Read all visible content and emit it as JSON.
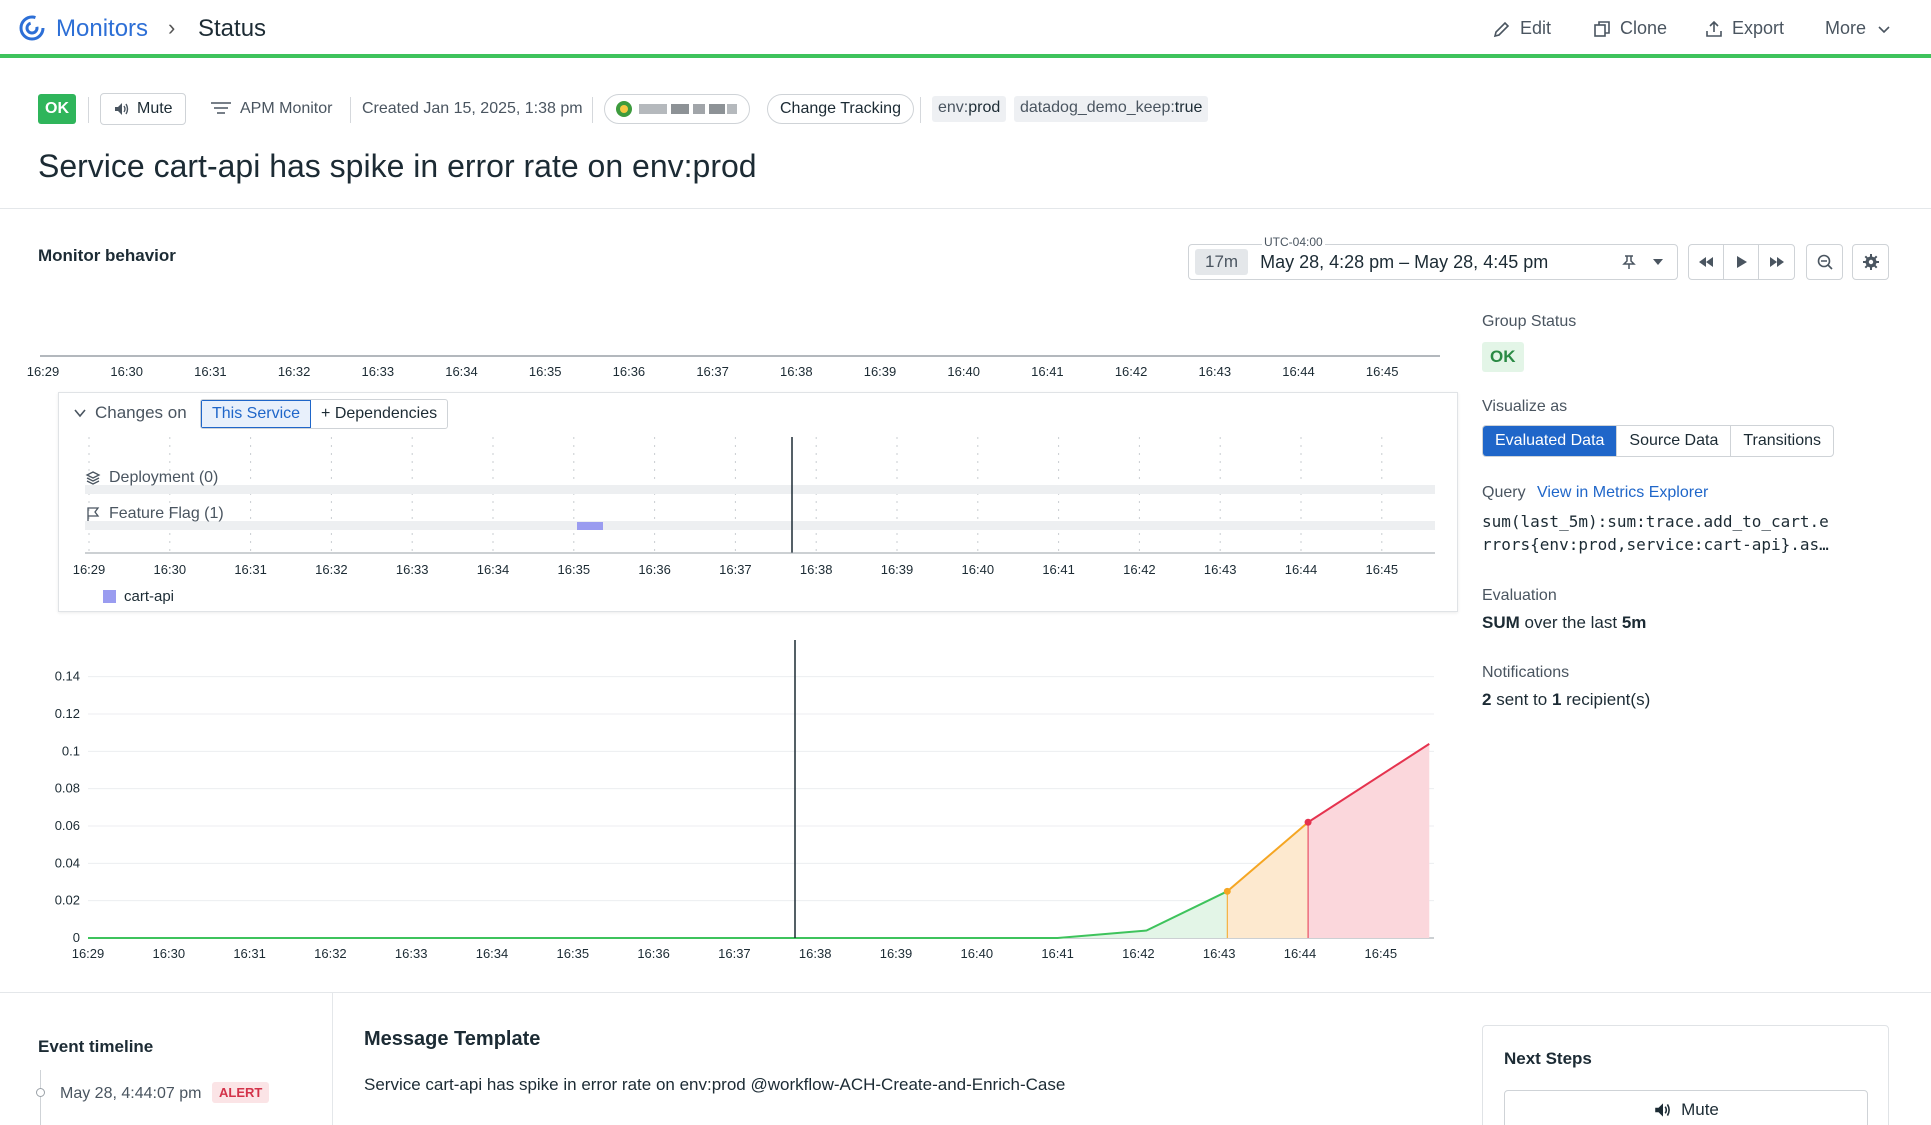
{
  "breadcrumb": {
    "root": "Monitors",
    "current": "Status"
  },
  "toolbar": {
    "edit": "Edit",
    "clone": "Clone",
    "export": "Export",
    "more": "More"
  },
  "header": {
    "status": "OK",
    "mute": "Mute",
    "monitor_type": "APM Monitor",
    "created": "Created Jan 15, 2025, 1:38 pm",
    "change_tracking": "Change Tracking",
    "tags": [
      {
        "key": "env:",
        "value": "prod"
      },
      {
        "key": "datadog_demo_keep:",
        "value": "true"
      }
    ],
    "title": "Service cart-api has spike in error rate on env:prod"
  },
  "behavior": {
    "title": "Monitor behavior",
    "timezone": "UTC-04:00",
    "duration": "17m",
    "range": "May 28, 4:28 pm – May 28, 4:45 pm"
  },
  "time_ticks": [
    "16:29",
    "16:30",
    "16:31",
    "16:32",
    "16:33",
    "16:34",
    "16:35",
    "16:36",
    "16:37",
    "16:38",
    "16:39",
    "16:40",
    "16:41",
    "16:42",
    "16:43",
    "16:44",
    "16:45"
  ],
  "changes": {
    "label": "Changes on",
    "this_service": "This Service",
    "dependencies": "+ Dependencies",
    "deployment": "Deployment (0)",
    "feature_flag": "Feature Flag (1)",
    "legend": "cart-api",
    "legend_color": "#9a9cf0"
  },
  "chart_data": {
    "type": "area",
    "x": [
      "16:29",
      "16:30",
      "16:31",
      "16:32",
      "16:33",
      "16:34",
      "16:35",
      "16:36",
      "16:37",
      "16:38",
      "16:39",
      "16:40",
      "16:41",
      "16:42",
      "16:43",
      "16:44",
      "16:45"
    ],
    "y_ticks": [
      "0",
      "0.02",
      "0.04",
      "0.06",
      "0.08",
      "0.1",
      "0.12",
      "0.14"
    ],
    "ylim": [
      0,
      0.15
    ],
    "points": [
      {
        "t": 0,
        "v": 0
      },
      {
        "t": 12,
        "v": 0
      },
      {
        "t": 13.1,
        "v": 0.004
      },
      {
        "t": 14.1,
        "v": 0.025
      },
      {
        "t": 15.1,
        "v": 0.062
      },
      {
        "t": 16.6,
        "v": 0.104
      }
    ],
    "marker_time": 8.75,
    "segments": [
      {
        "from": 0,
        "to": 3,
        "state": "ok",
        "color": "#3ec35c",
        "fill": "#e3f5e7"
      },
      {
        "from": 3,
        "to": 4,
        "state": "warn",
        "color": "#f5a623",
        "fill": "#fde9cf"
      },
      {
        "from": 4,
        "to": 5,
        "state": "alert",
        "color": "#e5334f",
        "fill": "#fbd7dc"
      }
    ]
  },
  "side": {
    "group_status_label": "Group Status",
    "group_status": "OK",
    "visualize_label": "Visualize as",
    "visualize_options": [
      "Evaluated Data",
      "Source Data",
      "Transitions"
    ],
    "query_label": "Query",
    "query_link": "View in Metrics Explorer",
    "query_line1": "sum(last_5m):sum:trace.add_to_cart.e",
    "query_line2": "rrors{env:prod,service:cart-api}.as…",
    "evaluation_label": "Evaluation",
    "evaluation_agg": "SUM",
    "evaluation_mid": " over the last ",
    "evaluation_window": "5m",
    "notifications_label": "Notifications",
    "notif_sent": "2",
    "notif_mid": " sent to ",
    "notif_count": "1",
    "notif_tail": " recipient(s)"
  },
  "bottom": {
    "event_timeline": "Event timeline",
    "event_time": "May 28, 4:44:07 pm",
    "event_status": "ALERT",
    "message_title": "Message Template",
    "message_text": "Service cart-api has spike in error rate on env:prod @workflow-ACH-Create-and-Enrich-Case",
    "next_steps": "Next Steps",
    "mute": "Mute"
  }
}
